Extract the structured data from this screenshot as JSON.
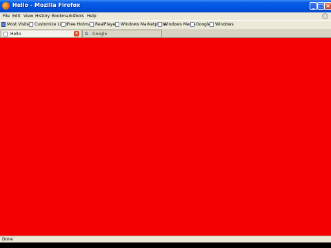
{
  "window": {
    "title": "Hello - Mozilla Firefox"
  },
  "menubar": {
    "items": [
      "File",
      "Edit",
      "View",
      "History",
      "Bookmarks",
      "Tools",
      "Help"
    ]
  },
  "bookmarks": {
    "items": [
      "Most Visited",
      "Customize Links",
      "Free Hotmail",
      "RealPlayer",
      "Windows Marketplace",
      "Windows Media",
      "Google",
      "Windows"
    ]
  },
  "tabs": [
    {
      "label": "Hello",
      "active": true
    },
    {
      "label": "Google",
      "active": false
    }
  ],
  "content": {
    "background_color": "#f50000"
  },
  "statusbar": {
    "text": "Done"
  },
  "colors": {
    "titlebar": "#0054e3",
    "chrome": "#ece9d8",
    "page": "#f50000"
  }
}
